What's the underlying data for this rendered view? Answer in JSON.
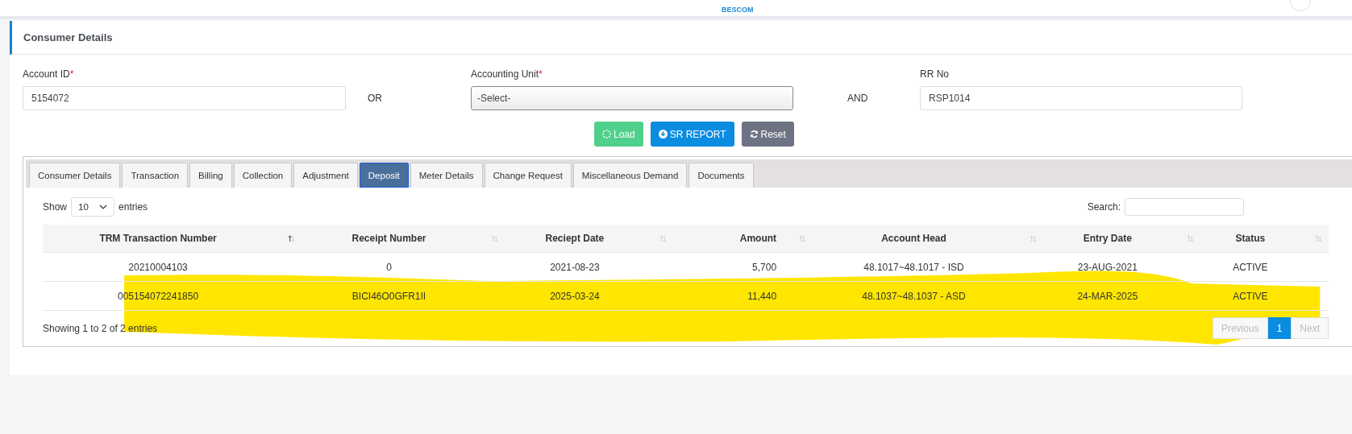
{
  "top_bar": {
    "logo_text": "BESCOM"
  },
  "card": {
    "title": "Consumer Details"
  },
  "form": {
    "fields": [
      {
        "kind": "input",
        "label": "Account ID",
        "required_mark": "*",
        "value": "5154072"
      },
      {
        "kind": "connector",
        "text": "OR"
      },
      {
        "kind": "select",
        "label": "Accounting Unit",
        "required_mark": "*",
        "value": "-Select-"
      },
      {
        "kind": "connector",
        "text": "AND"
      },
      {
        "kind": "input",
        "label": "RR No",
        "value": "RSP1014"
      }
    ]
  },
  "buttons": [
    {
      "kind": "load",
      "label": "Load"
    },
    {
      "kind": "report",
      "label": "SR REPORT"
    },
    {
      "kind": "reset",
      "label": "Reset"
    }
  ],
  "tabs": [
    {
      "label": "Consumer Details",
      "selected": false
    },
    {
      "label": "Transaction",
      "selected": false
    },
    {
      "label": "Billing",
      "selected": false
    },
    {
      "label": "Collection",
      "selected": false
    },
    {
      "label": "Adjustment",
      "selected": false
    },
    {
      "label": "Deposit",
      "selected": true
    },
    {
      "label": "Meter Details",
      "selected": false
    },
    {
      "label": "Change Request",
      "selected": false
    },
    {
      "label": "Miscellaneous Demand",
      "selected": false
    },
    {
      "label": "Documents",
      "selected": false
    }
  ],
  "length_menu": {
    "prefix": "Show",
    "value": "10",
    "suffix": "entries"
  },
  "search": {
    "label": "Search:"
  },
  "table": {
    "columns": [
      {
        "label": "TRM Transaction Number",
        "sorted_ascending": true,
        "numeric": false
      },
      {
        "label": "Receipt Number",
        "sorted_ascending": false,
        "numeric": false
      },
      {
        "label": "Reciept Date",
        "sorted_ascending": false,
        "numeric": false
      },
      {
        "label": "Amount",
        "sorted_ascending": false,
        "numeric": true
      },
      {
        "label": "Account Head",
        "sorted_ascending": false,
        "numeric": false
      },
      {
        "label": "Entry Date",
        "sorted_ascending": false,
        "numeric": false
      },
      {
        "label": "Status",
        "sorted_ascending": false,
        "numeric": false
      }
    ],
    "rows": [
      [
        "20210004103",
        "0",
        "2021-08-23",
        "5,700",
        "48.1017~48.1017 - ISD",
        "23-AUG-2021",
        "ACTIVE"
      ],
      [
        "005154072241850",
        "BICI46O0GFR1II",
        "2025-03-24",
        "11,440",
        "48.1037~48.1037 - ASD",
        "24-MAR-2025",
        "ACTIVE"
      ]
    ]
  },
  "info": "Showing 1 to 2 of 2 entries",
  "pagination": {
    "previous": {
      "label": "Previous",
      "disabled": true
    },
    "pages": [
      {
        "label": "1",
        "selected": true
      }
    ],
    "next": {
      "label": "Next",
      "disabled": true
    }
  },
  "annotation": {
    "kind": "highlighter"
  }
}
